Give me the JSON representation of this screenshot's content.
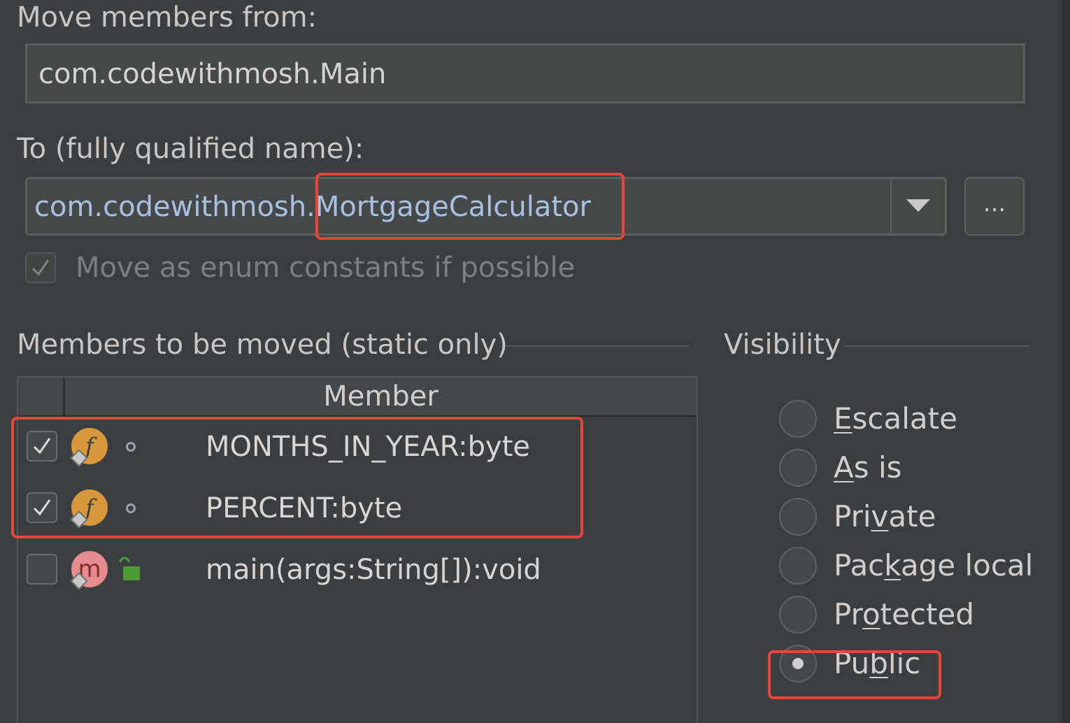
{
  "move_from": {
    "label": "Move members from:",
    "value": "com.codewithmosh.Main"
  },
  "move_to": {
    "label": "To (fully qualified name):",
    "value_prefix": "com.codewithmosh",
    "value_highlight": ".MortgageCalculator",
    "browse_label": "..."
  },
  "enum_checkbox": {
    "label": "Move as enum constants if possible",
    "checked": true
  },
  "members": {
    "section_title": "Members to be moved (static only)",
    "column_header": "Member",
    "rows": [
      {
        "checked": true,
        "icon": "field-icon",
        "icon_letter": "f",
        "visibility_icon": "package-private-icon",
        "text": "MONTHS_IN_YEAR:byte"
      },
      {
        "checked": true,
        "icon": "field-icon",
        "icon_letter": "f",
        "visibility_icon": "package-private-icon",
        "text": "PERCENT:byte"
      },
      {
        "checked": false,
        "icon": "method-icon",
        "icon_letter": "m",
        "visibility_icon": "public-lock-icon",
        "text": "main(args:String[]):void"
      }
    ]
  },
  "visibility": {
    "section_title": "Visibility",
    "options": [
      {
        "pre": "",
        "mn": "E",
        "post": "scalate",
        "selected": false
      },
      {
        "pre": "",
        "mn": "A",
        "post": "s is",
        "selected": false
      },
      {
        "pre": "Pri",
        "mn": "v",
        "post": "ate",
        "selected": false
      },
      {
        "pre": "Pac",
        "mn": "k",
        "post": "age local",
        "selected": false
      },
      {
        "pre": "Pr",
        "mn": "o",
        "post": "tected",
        "selected": false
      },
      {
        "pre": "Pu",
        "mn": "b",
        "post": "lic",
        "selected": true
      }
    ]
  },
  "colors": {
    "highlight_border": "#e8463a",
    "background": "#3c3f41",
    "field_icon": "#d8973a",
    "method_icon": "#e58d8d"
  }
}
